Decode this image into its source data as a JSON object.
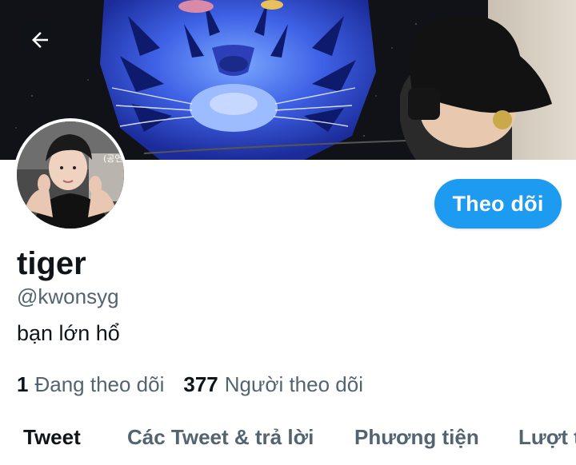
{
  "header": {
    "back_icon": "arrow-left-icon"
  },
  "profile": {
    "name": "tiger",
    "handle": "@kwonsyg",
    "bio": "bạn lớn hổ",
    "avatar_caption": "(공연"
  },
  "follow_button": {
    "label": "Theo dõi",
    "color": "#1d9bf0"
  },
  "stats": [
    {
      "count": "1",
      "label": "Đang theo dõi"
    },
    {
      "count": "377",
      "label": "Người theo dõi"
    }
  ],
  "tabs": [
    {
      "label": "Tweet",
      "active": true
    },
    {
      "label": "Các Tweet & trả lời",
      "active": false
    },
    {
      "label": "Phương tiện",
      "active": false
    },
    {
      "label": "Lượt t",
      "active": false
    }
  ]
}
